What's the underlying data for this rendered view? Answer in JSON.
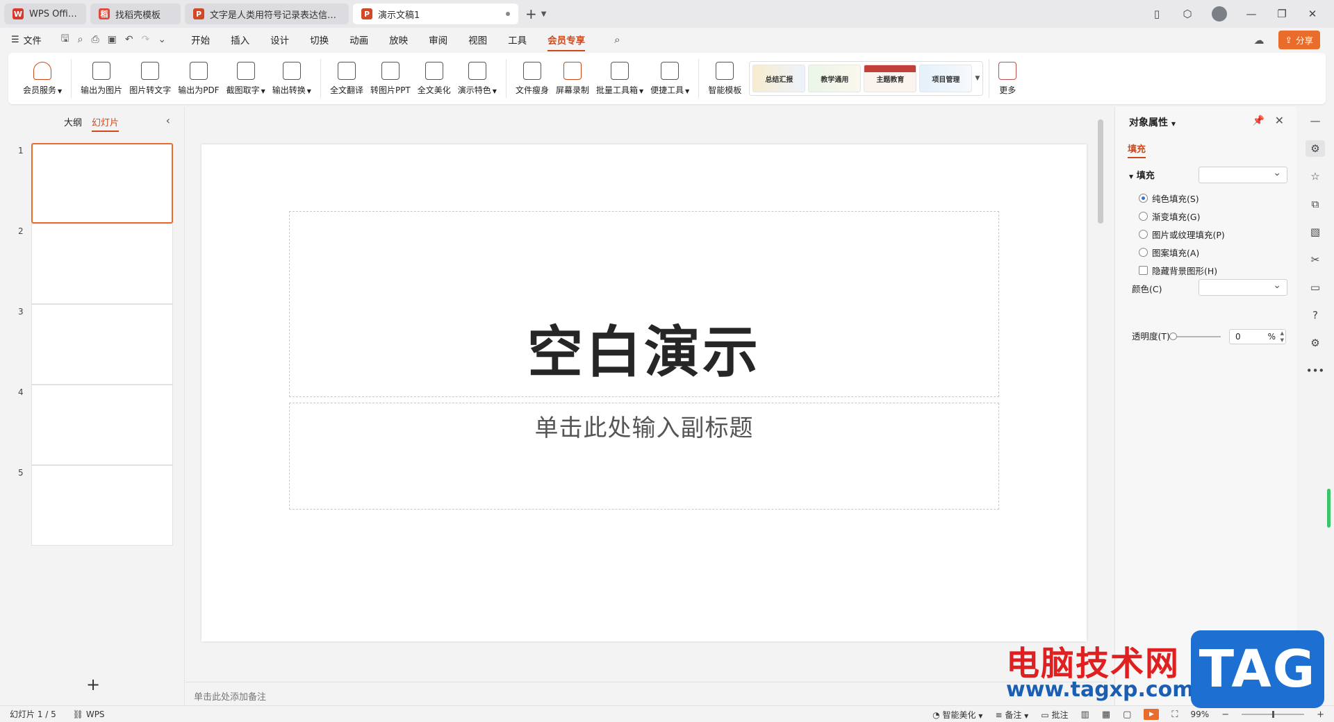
{
  "tabs": [
    {
      "label": "WPS Office",
      "icon": "wps-logo-icon",
      "color": "#d73a2d"
    },
    {
      "label": "找稻壳模板",
      "icon": "docer-logo-icon",
      "color": "#e04a3a"
    },
    {
      "label": "文字是人类用符号记录表达信息以传之",
      "icon": "ppt-file-icon",
      "color": "#d24726"
    },
    {
      "label": "演示文稿1",
      "icon": "ppt-file-icon",
      "color": "#d24726"
    }
  ],
  "menubar": {
    "file_label": "文件",
    "items": [
      "开始",
      "插入",
      "设计",
      "切换",
      "动画",
      "放映",
      "审阅",
      "视图",
      "工具",
      "会员专享"
    ],
    "active": "会员专享",
    "share_label": "分享"
  },
  "ribbon": {
    "groups": [
      [
        {
          "label": "会员服务",
          "dropdown": true
        }
      ],
      [
        {
          "label": "输出为图片"
        },
        {
          "label": "图片转文字"
        },
        {
          "label": "输出为PDF"
        },
        {
          "label": "截图取字",
          "dropdown": true
        },
        {
          "label": "输出转换",
          "dropdown": true
        }
      ],
      [
        {
          "label": "全文翻译"
        },
        {
          "label": "转图片PPT"
        },
        {
          "label": "全文美化"
        },
        {
          "label": "演示特色",
          "dropdown": true
        }
      ],
      [
        {
          "label": "文件瘦身"
        },
        {
          "label": "屏幕录制"
        },
        {
          "label": "批量工具箱",
          "dropdown": true
        },
        {
          "label": "便捷工具",
          "dropdown": true
        }
      ],
      [
        {
          "label": "智能模板"
        }
      ]
    ],
    "templates": [
      "总结汇报",
      "教学通用",
      "主题教育",
      "项目管理"
    ],
    "more_label": "更多"
  },
  "left_panel": {
    "tabs": [
      "大纲",
      "幻灯片"
    ],
    "active_tab": "幻灯片",
    "slides": [
      "1",
      "2",
      "3",
      "4",
      "5"
    ],
    "selected": 1
  },
  "slide": {
    "title": "空白演示",
    "subtitle": "单击此处输入副标题"
  },
  "notes_placeholder": "单击此处添加备注",
  "properties": {
    "title": "对象属性",
    "tab": "填充",
    "section": "填充",
    "options": [
      {
        "label": "纯色填充(S)",
        "type": "radio",
        "checked": true
      },
      {
        "label": "渐变填充(G)",
        "type": "radio",
        "checked": false
      },
      {
        "label": "图片或纹理填充(P)",
        "type": "radio",
        "checked": false
      },
      {
        "label": "图案填充(A)",
        "type": "radio",
        "checked": false
      },
      {
        "label": "隐藏背景图形(H)",
        "type": "checkbox",
        "checked": false
      }
    ],
    "color_label": "颜色(C)",
    "transparency_label": "透明度(T)",
    "transparency_value": "0",
    "transparency_unit": "%"
  },
  "statusbar": {
    "slide_counter": "幻灯片 1 / 5",
    "brand": "WPS",
    "beautify": "智能美化",
    "notes": "备注",
    "comments": "批注",
    "zoom": "99%"
  },
  "watermark": {
    "text": "电脑技术网",
    "url": "www.tagxp.com",
    "tag": "TAG"
  },
  "colors": {
    "accent": "#d0481a",
    "share": "#e96c2b",
    "selection": "#e96c2b"
  }
}
